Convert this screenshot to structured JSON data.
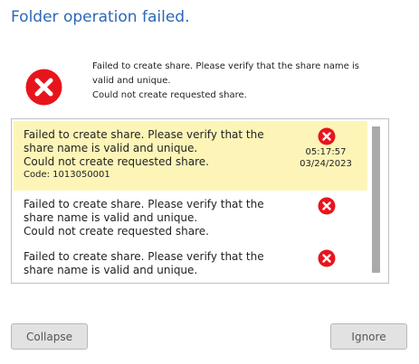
{
  "dialog": {
    "title": "Folder operation failed.",
    "summary_line1": "Failed to create share. Please verify that the share name is",
    "summary_line2": "valid and unique.",
    "summary_line3": "Could not create requested share."
  },
  "log": {
    "entries": [
      {
        "line1": "Failed to create share. Please verify that the",
        "line2": "share name is valid and unique.",
        "line3": "Could not create requested share.",
        "code": "Code: 1013050001",
        "time": "05:17:57",
        "date": "03/24/2023",
        "selected": true
      },
      {
        "line1": "Failed to create share. Please verify that the",
        "line2": "share name is valid and unique.",
        "line3": "Could not create requested share."
      },
      {
        "line1": "Failed to create share. Please verify that the",
        "line2": "share name is valid and unique."
      }
    ]
  },
  "buttons": {
    "collapse": "Collapse",
    "ignore": "Ignore"
  },
  "colors": {
    "title": "#2b67b8",
    "error_red": "#e8141c",
    "selected_row": "#fdf5b8"
  },
  "icons": {
    "error": "error-x-circle-icon"
  }
}
